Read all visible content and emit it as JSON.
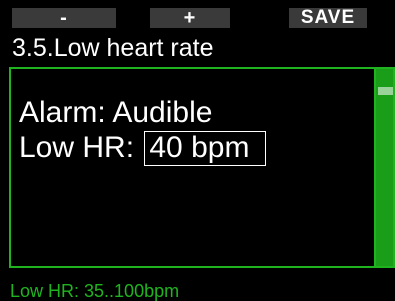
{
  "softkeys": {
    "left": "-",
    "middle": "+",
    "right": "SAVE"
  },
  "title": "3.5.Low heart rate",
  "settings": {
    "alarm_label": "Alarm:",
    "alarm_value": "Audible",
    "low_hr_label": "Low HR:",
    "low_hr_value": "40 bpm"
  },
  "footer": {
    "hint": "Low HR: 35..100bpm"
  },
  "colors": {
    "accent": "#1fb41f",
    "background": "#000000",
    "softkey_bg": "#3a3a3a"
  }
}
